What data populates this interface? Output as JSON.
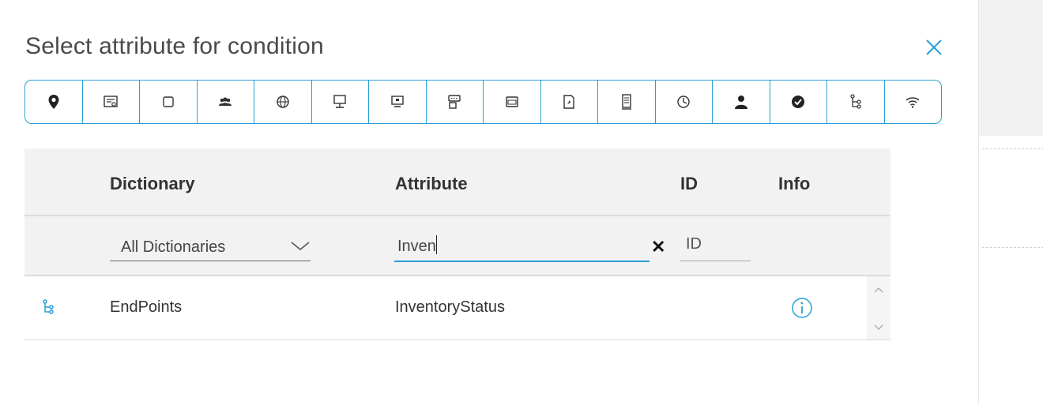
{
  "dialog": {
    "title": "Select attribute for condition",
    "close_icon": "close-icon",
    "accent": "#2a9fd6"
  },
  "toolbar": {
    "icons": [
      "location-pin-icon",
      "identity-card-icon",
      "square-icon",
      "group-icon",
      "globe-icon",
      "computer-icon",
      "monitor-icon",
      "network-device-icon",
      "inbox-icon",
      "certificate-document-icon",
      "server-icon",
      "clock-icon",
      "user-icon",
      "check-circle-icon",
      "endpoint-tree-icon",
      "wifi-icon"
    ]
  },
  "table": {
    "headers": {
      "dictionary": "Dictionary",
      "attribute": "Attribute",
      "id": "ID",
      "info": "Info"
    },
    "filters": {
      "dictionary_selected": "All Dictionaries",
      "attribute_value": "Inven",
      "id_placeholder": "ID"
    },
    "rows": [
      {
        "icon": "endpoint-tree-icon",
        "dictionary": "EndPoints",
        "attribute": "InventoryStatus",
        "id": "",
        "info_icon": "info-icon"
      }
    ]
  }
}
